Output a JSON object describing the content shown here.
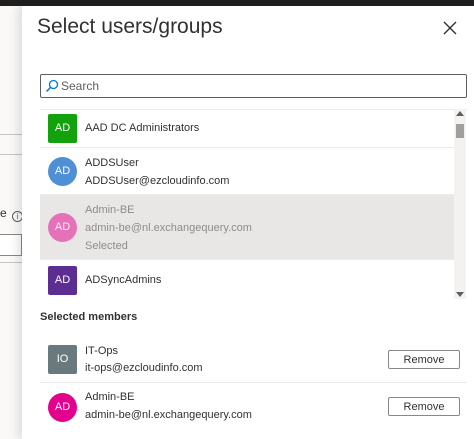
{
  "panel": {
    "title": "Select users/groups"
  },
  "search": {
    "placeholder": "Search",
    "value": ""
  },
  "list": {
    "items": [
      {
        "initials": "AD",
        "name": "AAD DC Administrators",
        "email": "",
        "status": "",
        "avatar_color": "#13a10e",
        "shape": "square"
      },
      {
        "initials": "AD",
        "name": "ADDSUser",
        "email": "ADDSUser@ezcloudinfo.com",
        "status": "",
        "avatar_color": "#4f8fd6",
        "shape": "circle"
      },
      {
        "initials": "AD",
        "name": "Admin-BE",
        "email": "admin-be@nl.exchangequery.com",
        "status": "Selected",
        "avatar_color": "#e3008c",
        "shape": "circle"
      },
      {
        "initials": "AD",
        "name": "ADSyncAdmins",
        "email": "",
        "status": "",
        "avatar_color": "#5c2e91",
        "shape": "square"
      }
    ]
  },
  "selected": {
    "title": "Selected members",
    "members": [
      {
        "initials": "IO",
        "name": "IT-Ops",
        "email": "it-ops@ezcloudinfo.com",
        "avatar_color": "#69797e",
        "shape": "square",
        "button": "Remove"
      },
      {
        "initials": "AD",
        "name": "Admin-BE",
        "email": "admin-be@nl.exchangequery.com",
        "avatar_color": "#e3008c",
        "shape": "circle",
        "button": "Remove"
      }
    ]
  },
  "background": {
    "letter": "e",
    "info_icon": "i"
  },
  "colors": {
    "topbar": "#1f1f1f",
    "panel_bg": "#ffffff",
    "selected_row_bg": "#e8e7e6"
  }
}
